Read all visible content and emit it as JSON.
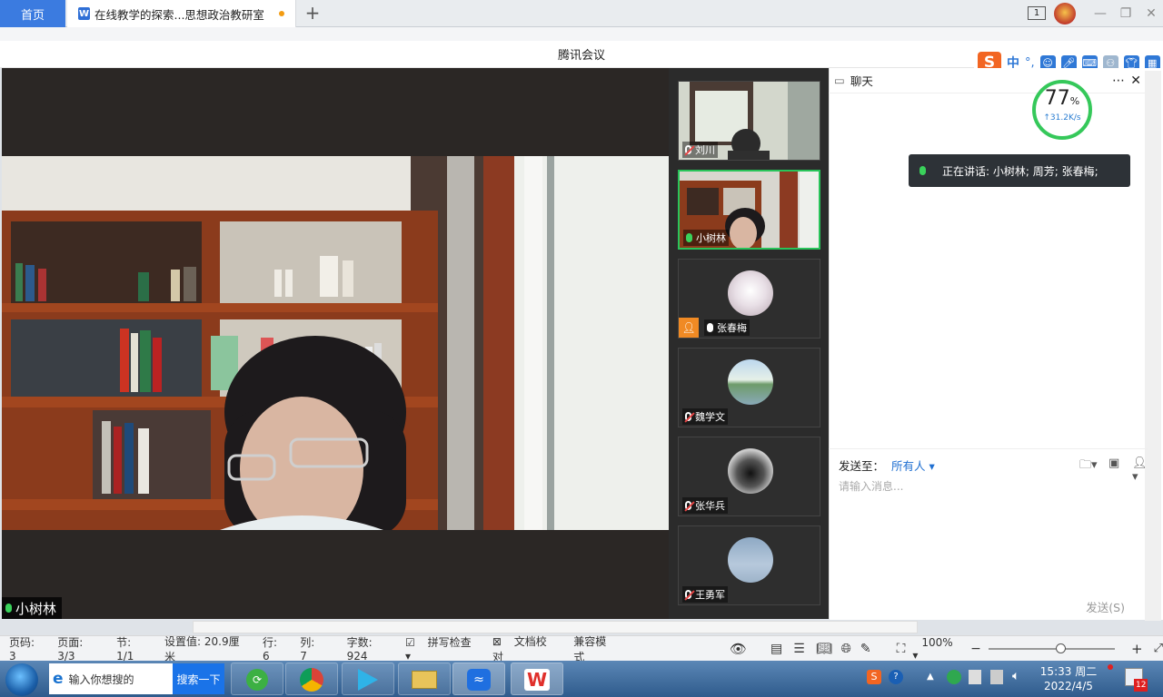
{
  "wps": {
    "home_tab": "首页",
    "doc_tab": "在线教学的探索...思想政治教研室",
    "tab_badge": "1"
  },
  "meeting": {
    "window_title": "腾讯会议",
    "speaker_label": "小树林",
    "participants": [
      {
        "name": "刘川",
        "mic": "off"
      },
      {
        "name": "小树林",
        "mic": "on",
        "active": true
      },
      {
        "name": "张春梅",
        "mic": "on"
      },
      {
        "name": "魏学文",
        "mic": "off"
      },
      {
        "name": "张华兵",
        "mic": "off"
      },
      {
        "name": "王勇军",
        "mic": "off"
      }
    ]
  },
  "chat": {
    "title": "聊天",
    "speaking_now": "正在讲话: 小树林; 周芳; 张春梅;",
    "send_to_label": "发送至：",
    "send_to_value": "所有人",
    "input_placeholder": "请输入消息...",
    "send_button": "发送(S)"
  },
  "speed_widget": {
    "percent": "77",
    "percent_sign": "%",
    "rate": "↑31.2K/s"
  },
  "ime": {
    "lang": "中"
  },
  "status_bar": {
    "page_code": "页码: 3",
    "page": "页面: 3/3",
    "section": "节: 1/1",
    "setting": "设置值: 20.9厘米",
    "row": "行: 6",
    "col": "列: 7",
    "words": "字数: 924",
    "spell": "拼写检查",
    "proof": "文档校对",
    "compat": "兼容模式",
    "zoom": "100%"
  },
  "taskbar": {
    "search_placeholder": "输入你想搜的",
    "search_button": "搜索一下",
    "time": "15:33 周二",
    "date": "2022/4/5",
    "notify_count": "12"
  }
}
